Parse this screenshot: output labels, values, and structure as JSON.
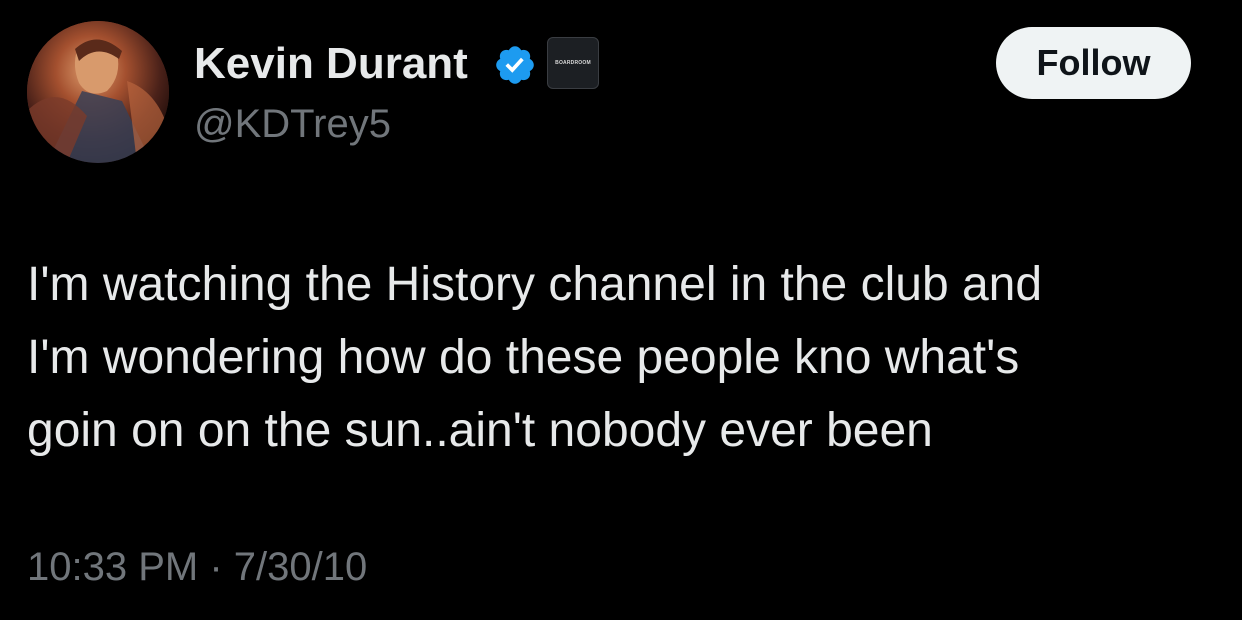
{
  "author": {
    "display_name": "Kevin Durant",
    "handle": "@KDTrey5",
    "verified": true,
    "affiliate_badge_text": "BOARDROOM"
  },
  "actions": {
    "follow_label": "Follow"
  },
  "tweet": {
    "text_lines": [
      "I'm watching the History channel in the club and",
      "I'm wondering how do these people kno what's",
      "goin on on the sun..ain't nobody ever been"
    ],
    "time": "10:33 PM",
    "separator": "·",
    "date": "7/30/10"
  },
  "icons": {
    "verified": "verified-badge-icon",
    "avatar": "profile-avatar"
  },
  "colors": {
    "background": "#000000",
    "primary_text": "#e7e9ea",
    "secondary_text": "#71767b",
    "verified_blue": "#1d9bf0",
    "follow_bg": "#eff3f4",
    "follow_text": "#0f1419"
  }
}
